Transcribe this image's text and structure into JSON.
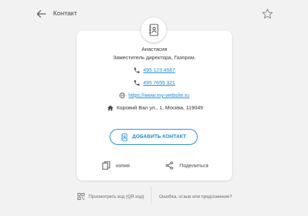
{
  "header": {
    "title": "Контакт",
    "back_icon": "arrow-left-icon",
    "favorite_icon": "star-outline-icon"
  },
  "contact": {
    "avatar_icon": "contact-book-icon",
    "name": "Анастасия",
    "position": "Заместитель директора, Газпром.",
    "phones": [
      "495 123 4567",
      "495 7655 321"
    ],
    "website": "https://www.my-website.ru",
    "address": "Коровий Вал ул., 1, Москва, 119049"
  },
  "actions": {
    "add_contact": "ДОБАВИТЬ КОНТАКТ",
    "copy": "копия",
    "share": "Поделиться"
  },
  "footer": {
    "qr": "Просмотреть код (QR код)",
    "feedback": "Ошибка, отзыв или предложение?"
  },
  "colors": {
    "accent": "#1a8ad4",
    "background": "#f2f2f2",
    "card": "#ffffff"
  }
}
